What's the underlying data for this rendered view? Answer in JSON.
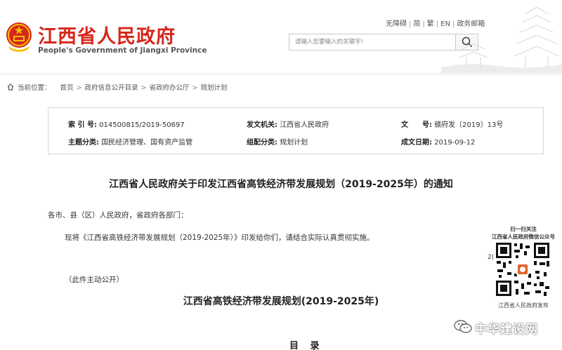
{
  "header": {
    "site_title": "江西省人民政府",
    "site_subtitle": "People's Government of Jiangxi Province",
    "top_links": [
      "无障碍",
      "简",
      "繁",
      "EN",
      "政务邮箱"
    ],
    "search_placeholder": "请输入您要输入的关键字!",
    "brand_color": "#d7261b"
  },
  "breadcrumb": {
    "label": "当前位置：",
    "items": [
      "首页",
      "政府信息公开目录",
      "省政府办公厅",
      "规划计划"
    ]
  },
  "meta": {
    "index_label": "索 引 号:",
    "index_value": "014500815/2019-50697",
    "issuer_label": "发文机关:",
    "issuer_value": "江西省人民政府",
    "docno_label": "文　　号:",
    "docno_value": "赣府发〔2019〕13号",
    "topic_label": "主题分类:",
    "topic_value": "国民经济管理、国有资产监管",
    "category_label": "组配分类:",
    "category_value": "规划计划",
    "date_label": "成文日期:",
    "date_value": "2019-09-12"
  },
  "document": {
    "title": "江西省人民政府关于印发江西省高铁经济带发展规划（2019-2025年）的通知",
    "salutation": "各市、县（区）人民政府，省政府各部门：",
    "paragraph": "现将《江西省高铁经济带发展规划（2019-2025年）》印发给你们，请结合实际认真贯彻实施。",
    "note": "（此件主动公开）",
    "plan_title": "江西省高铁经济带发展规划(2019-2025年)",
    "toc_heading": "目 录"
  },
  "qr_panel": {
    "line1": "扫一扫关注",
    "line2": "江西省人民政府微信公众号",
    "partial_date": "2(",
    "caption": "江西省人民政府发布"
  },
  "watermark": {
    "text": "中华建设网",
    "icon": "wechat-icon"
  }
}
